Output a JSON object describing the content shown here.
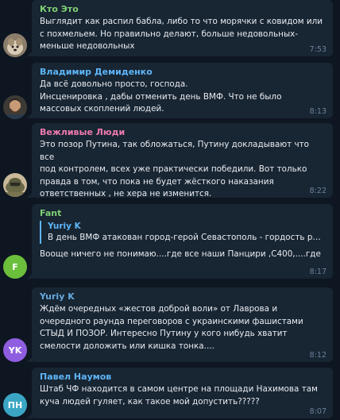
{
  "messages": [
    {
      "sender": "Кто Это",
      "sender_color": "#7ed074",
      "text": "Выглядит как распил бабла, либо то что морячки с ковидом или\nс похмельем. Но правильно делают, больше недовольных-\nменьше недовольных",
      "time": "7:53",
      "avatar_icon": "dog-photo-avatar"
    },
    {
      "sender": "Владимир Демиденко",
      "sender_color": "#5eb5f7",
      "text": "Да всё довольно просто, господа.\nИнсценировка , дабы отменить день ВМФ. Что не было\nмассовых скоплений людей.",
      "time": "8:13",
      "avatar_icon": "man-photo-avatar"
    },
    {
      "sender": "Вежливые Люди",
      "sender_color": "#ee7aae",
      "text": "Это позор Путина, так обложаться, Путину докладывают что все\nпод контролем, всех уже практически победили. Вот только\nправда в том, что пока не будет жёсткого наказания\nответственных , не хера не изменится.",
      "time": "8:22",
      "avatar_icon": "soldier-photo-avatar"
    },
    {
      "sender": "Fant",
      "sender_color": "#7ed074",
      "reply_name": "Yuriy K",
      "reply_text": "В день ВМФ атакован город-герой Севастополь - гордость ру...",
      "text": "Вооще ничего не понимаю....где все наши Панцири ,С400,....где",
      "time": "8:17",
      "avatar_letters": "F",
      "avatar_color": "#6bbf3b"
    },
    {
      "sender": "Yuriy K",
      "sender_color": "#65aadd",
      "text": "Ждём очередных «жестов доброй воли» от Лаврова и\nочередного раунда переговоров с украинскими фашистами\nСТЫД И ПОЗОР. Интересно Путину у кого нибудь хватит\nсмелости доложить или кишка тонка....",
      "time": "8:12",
      "avatar_letters": "YK",
      "avatar_color": "#8f5ee0"
    },
    {
      "sender": "Павел Наумов",
      "sender_color": "#5eb5f7",
      "text": "Штаб ЧФ находится в самом центре на площади Нахимова там\nкуча людей гуляет, как такое мой допустить?????",
      "time": "8:07",
      "avatar_letters": "ПН",
      "avatar_color": "#3aa6c4"
    }
  ]
}
